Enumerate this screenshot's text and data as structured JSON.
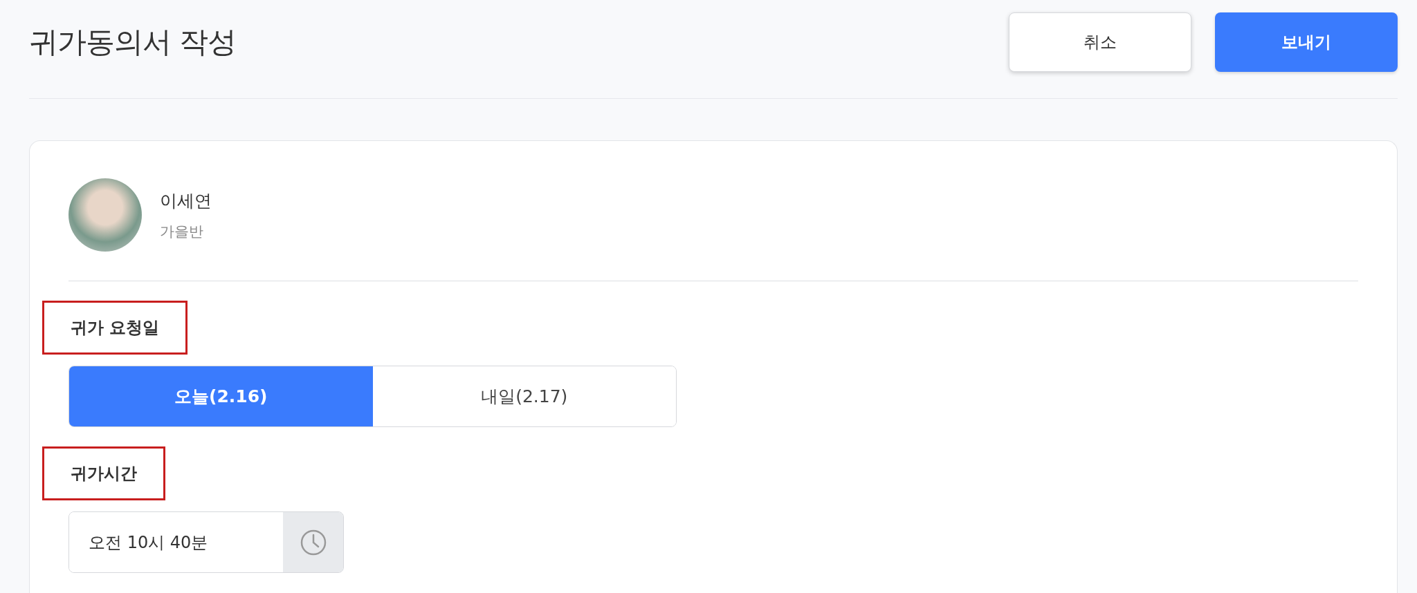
{
  "header": {
    "title": "귀가동의서 작성",
    "buttons": [
      {
        "label": "취소",
        "kind": "secondary"
      },
      {
        "label": "보내기",
        "kind": "primary"
      }
    ]
  },
  "student": {
    "name": "이세연",
    "class": "가을반"
  },
  "sections": [
    {
      "label": "귀가 요청일",
      "highlighted": true,
      "kind": "segments",
      "options": [
        {
          "label": "오늘(2.16)",
          "selected": true
        },
        {
          "label": "내일(2.17)",
          "selected": false
        }
      ]
    },
    {
      "label": "귀가시간",
      "highlighted": true,
      "kind": "time",
      "value": "오전 10시 40분"
    }
  ]
}
